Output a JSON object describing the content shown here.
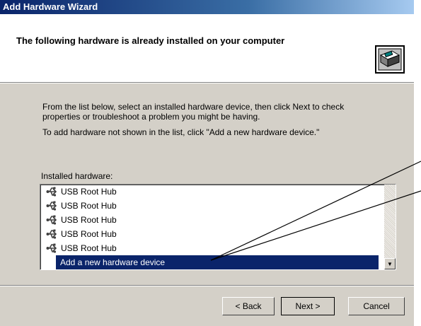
{
  "window": {
    "title": "Add Hardware Wizard"
  },
  "header": {
    "title": "The following hardware is already installed on your computer",
    "icon": "hardware-wizard-icon"
  },
  "body": {
    "instruction_line1": "From the list below, select an installed hardware device, then click Next to check",
    "instruction_line2": "properties or troubleshoot a problem you might be having.",
    "instruction_add": "To add hardware not shown in the list, click \"Add a new hardware device.\"",
    "list_label": "Installed hardware:"
  },
  "list": {
    "items": [
      {
        "label": "USB Root Hub",
        "icon": "usb-icon"
      },
      {
        "label": "USB Root Hub",
        "icon": "usb-icon"
      },
      {
        "label": "USB Root Hub",
        "icon": "usb-icon"
      },
      {
        "label": "USB Root Hub",
        "icon": "usb-icon"
      },
      {
        "label": "USB Root Hub",
        "icon": "usb-icon"
      }
    ],
    "selected": "Add a new hardware device"
  },
  "buttons": {
    "back": "< Back",
    "next": "Next >",
    "cancel": "Cancel"
  }
}
